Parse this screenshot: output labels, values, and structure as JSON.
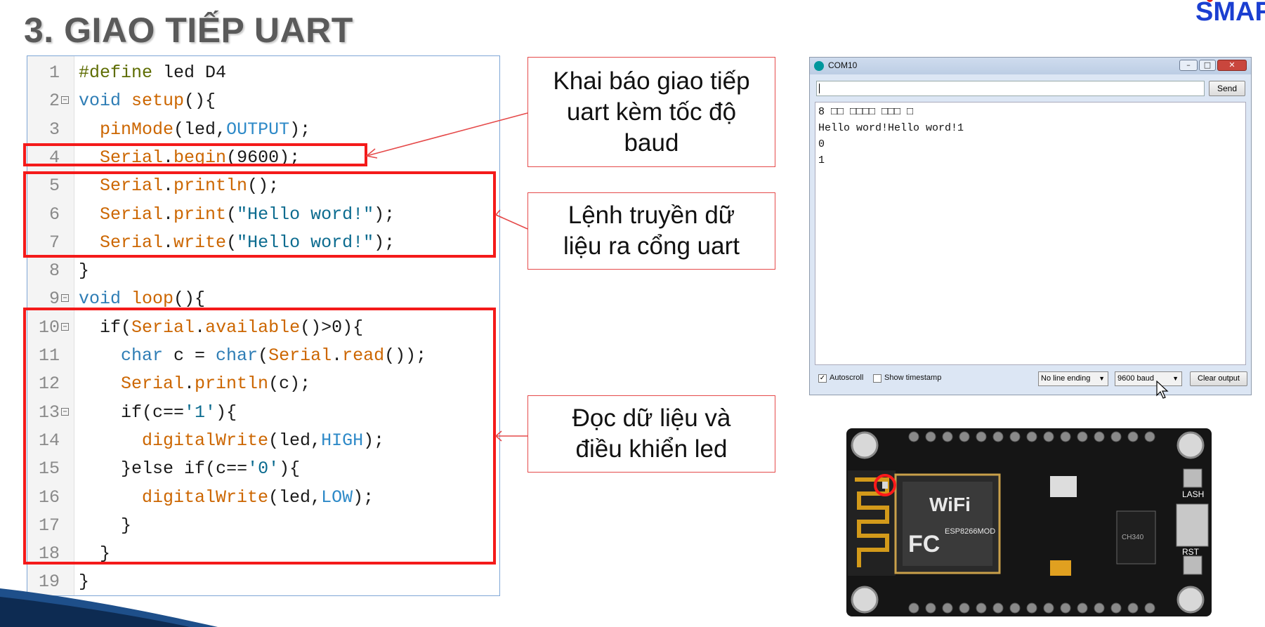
{
  "slide": {
    "title": "3. GIAO TIẾP UART",
    "brand": "SMAR"
  },
  "code": {
    "lines": [
      {
        "n": "1",
        "fold": false
      },
      {
        "n": "2",
        "fold": true
      },
      {
        "n": "3",
        "fold": false
      },
      {
        "n": "4",
        "fold": false
      },
      {
        "n": "5",
        "fold": false
      },
      {
        "n": "6",
        "fold": false
      },
      {
        "n": "7",
        "fold": false
      },
      {
        "n": "8",
        "fold": false
      },
      {
        "n": "9",
        "fold": true
      },
      {
        "n": "10",
        "fold": true
      },
      {
        "n": "11",
        "fold": false
      },
      {
        "n": "12",
        "fold": false
      },
      {
        "n": "13",
        "fold": true
      },
      {
        "n": "14",
        "fold": false
      },
      {
        "n": "15",
        "fold": false
      },
      {
        "n": "16",
        "fold": false
      },
      {
        "n": "17",
        "fold": false
      },
      {
        "n": "18",
        "fold": false
      },
      {
        "n": "19",
        "fold": false
      }
    ],
    "text": {
      "l1_a": "#define",
      "l1_b": " led D4",
      "l2_a": "void",
      "l2_b": " ",
      "l2_c": "setup",
      "l2_d": "(){",
      "l3_a": "  ",
      "l3_b": "pinMode",
      "l3_c": "(led,",
      "l3_d": "OUTPUT",
      "l3_e": ");",
      "l4_a": "  ",
      "l4_b": "Serial",
      "l4_c": ".",
      "l4_d": "begin",
      "l4_e": "(9600);",
      "l5_a": "  ",
      "l5_b": "Serial",
      "l5_c": ".",
      "l5_d": "println",
      "l5_e": "();",
      "l6_a": "  ",
      "l6_b": "Serial",
      "l6_c": ".",
      "l6_d": "print",
      "l6_e": "(",
      "l6_f": "\"Hello word!\"",
      "l6_g": ");",
      "l7_a": "  ",
      "l7_b": "Serial",
      "l7_c": ".",
      "l7_d": "write",
      "l7_e": "(",
      "l7_f": "\"Hello word!\"",
      "l7_g": ");",
      "l8_a": "}",
      "l9_a": "void",
      "l9_b": " ",
      "l9_c": "loop",
      "l9_d": "(){",
      "l10_a": "  ",
      "l10_b": "if",
      "l10_c": "(",
      "l10_d": "Serial",
      "l10_e": ".",
      "l10_f": "available",
      "l10_g": "()>0){",
      "l11_a": "    ",
      "l11_b": "char",
      "l11_c": " c = ",
      "l11_d": "char",
      "l11_e": "(",
      "l11_f": "Serial",
      "l11_g": ".",
      "l11_h": "read",
      "l11_i": "());",
      "l12_a": "    ",
      "l12_b": "Serial",
      "l12_c": ".",
      "l12_d": "println",
      "l12_e": "(c);",
      "l13_a": "    ",
      "l13_b": "if",
      "l13_c": "(c==",
      "l13_d": "'1'",
      "l13_e": "){",
      "l14_a": "      ",
      "l14_b": "digitalWrite",
      "l14_c": "(led,",
      "l14_d": "HIGH",
      "l14_e": ");",
      "l15_a": "    }",
      "l15_b": "else",
      "l15_c": " ",
      "l15_d": "if",
      "l15_e": "(c==",
      "l15_f": "'0'",
      "l15_g": "){",
      "l16_a": "      ",
      "l16_b": "digitalWrite",
      "l16_c": "(led,",
      "l16_d": "LOW",
      "l16_e": ");",
      "l17_a": "    }",
      "l18_a": "  }",
      "l19_a": "}"
    }
  },
  "callouts": {
    "c1": "Khai báo giao tiếp\nuart kèm tốc độ\nbaud",
    "c2": "Lệnh truyền dữ\nliệu ra cổng uart",
    "c3": "Đọc dữ liệu và\nđiều khiển led"
  },
  "serial_monitor": {
    "title": "COM10",
    "input_value": "",
    "send_label": "Send",
    "output": [
      "8 □□ □□□□ □□□ □",
      "Hello word!Hello word!1",
      "0",
      "1"
    ],
    "autoscroll_label": "Autoscroll",
    "autoscroll_checked": true,
    "timestamp_label": "Show timestamp",
    "timestamp_checked": false,
    "line_ending": "No line ending",
    "baud": "9600 baud",
    "clear_label": "Clear output"
  },
  "board": {
    "wifi_label": "WiFi",
    "module_label": "ESP8266MOD",
    "fc_label": "FC",
    "btn_flash": "LASH",
    "btn_rst": "RST",
    "chip_label": "CH340"
  },
  "colors": {
    "highlight": "#f41a1a",
    "callout_border": "#e54a4a",
    "title": "#5a5a5a",
    "brand": "#1b3fd1"
  }
}
